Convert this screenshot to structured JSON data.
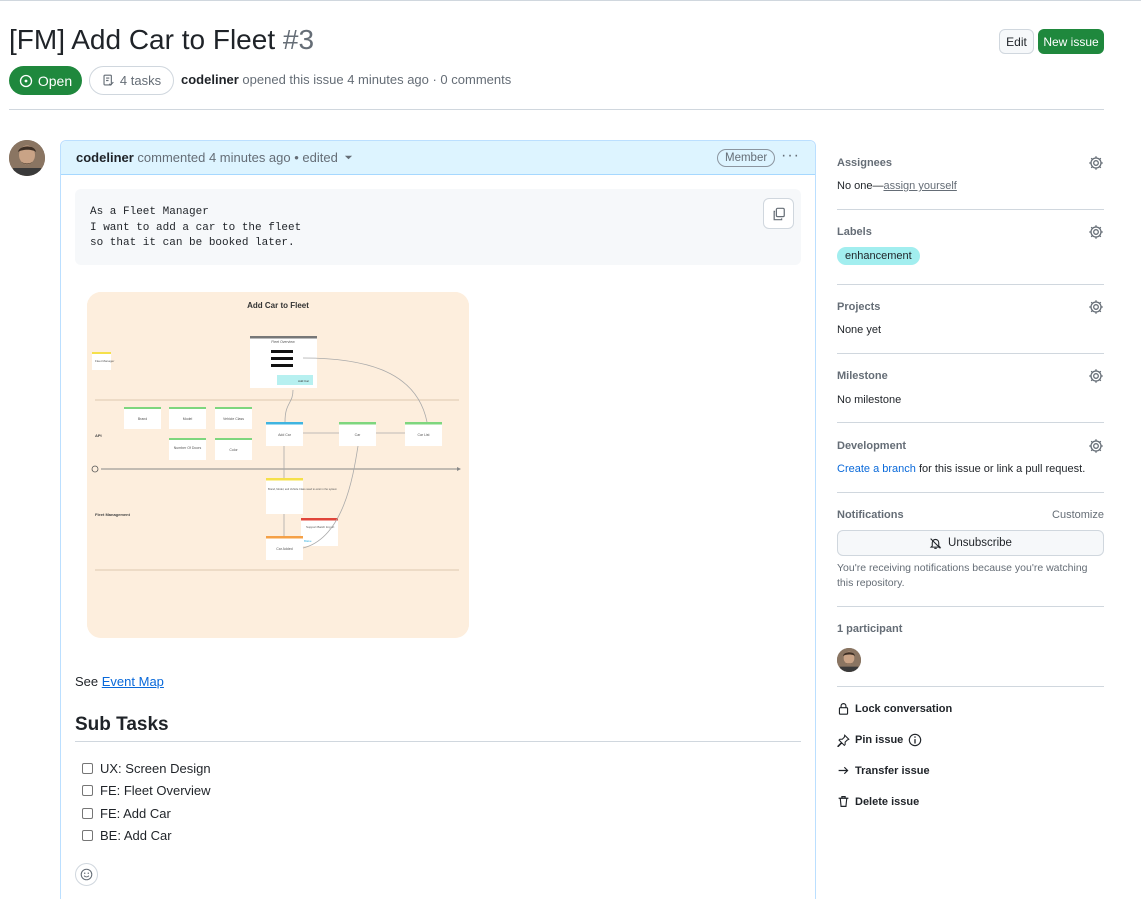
{
  "issue": {
    "title": "[FM] Add Car to Fleet",
    "number": "#3",
    "state": "Open",
    "tasks_label": "4 tasks",
    "author": "codeliner",
    "meta_text": "opened this issue 4 minutes ago · 0 comments"
  },
  "header_buttons": {
    "edit": "Edit",
    "new_issue": "New issue"
  },
  "comment": {
    "author": "codeliner",
    "meta": "commented 4 minutes ago • edited",
    "badge": "Member",
    "code_text": "As a Fleet Manager\nI want to add a car to the fleet\nso that it can be booked later.",
    "see_prefix": "See",
    "see_link": "Event Map",
    "subtasks_heading": "Sub Tasks",
    "subtasks": [
      {
        "label": "UX: Screen Design",
        "checked": false
      },
      {
        "label": "FE: Fleet Overview",
        "checked": false
      },
      {
        "label": "FE: Add Car",
        "checked": false
      },
      {
        "label": "BE: Add Car",
        "checked": false
      }
    ]
  },
  "diagram": {
    "title": "Add Car to Fleet",
    "actor": "Fleet Manager",
    "screen": "Fleet Overview",
    "screen_button": "Add Car",
    "lane_api": "API",
    "lane_fm": "Fleet Management",
    "fields": [
      "Brand",
      "Model",
      "Vehicle Class",
      "Number Of Doors",
      "Color"
    ],
    "command": "Add Car",
    "aggregate": "Car",
    "read_model": "Car List",
    "rule": "Brand, Model, and Vehicle Class need to exist in the system",
    "hotspot": "Support Batch Import",
    "hotspot_tag": "Blake",
    "event": "Car Added"
  },
  "sidebar": {
    "assignees": {
      "title": "Assignees",
      "value_prefix": "No one—",
      "value_link": "assign yourself"
    },
    "labels": {
      "title": "Labels",
      "items": [
        "enhancement"
      ]
    },
    "projects": {
      "title": "Projects",
      "value": "None yet"
    },
    "milestone": {
      "title": "Milestone",
      "value": "No milestone"
    },
    "development": {
      "title": "Development",
      "link": "Create a branch",
      "suffix": " for this issue or link a pull request."
    },
    "notifications": {
      "title": "Notifications",
      "customize": "Customize",
      "button": "Unsubscribe",
      "note": "You're receiving notifications because you're watching this repository."
    },
    "participants": {
      "title": "1 participant"
    },
    "actions": [
      "Lock conversation",
      "Pin issue",
      "Transfer issue",
      "Delete issue"
    ]
  },
  "colors": {
    "open_green": "#1f883d",
    "link_blue": "#0969da",
    "label_enhancement": "#a2eeef",
    "comment_header": "#ddf4ff"
  }
}
